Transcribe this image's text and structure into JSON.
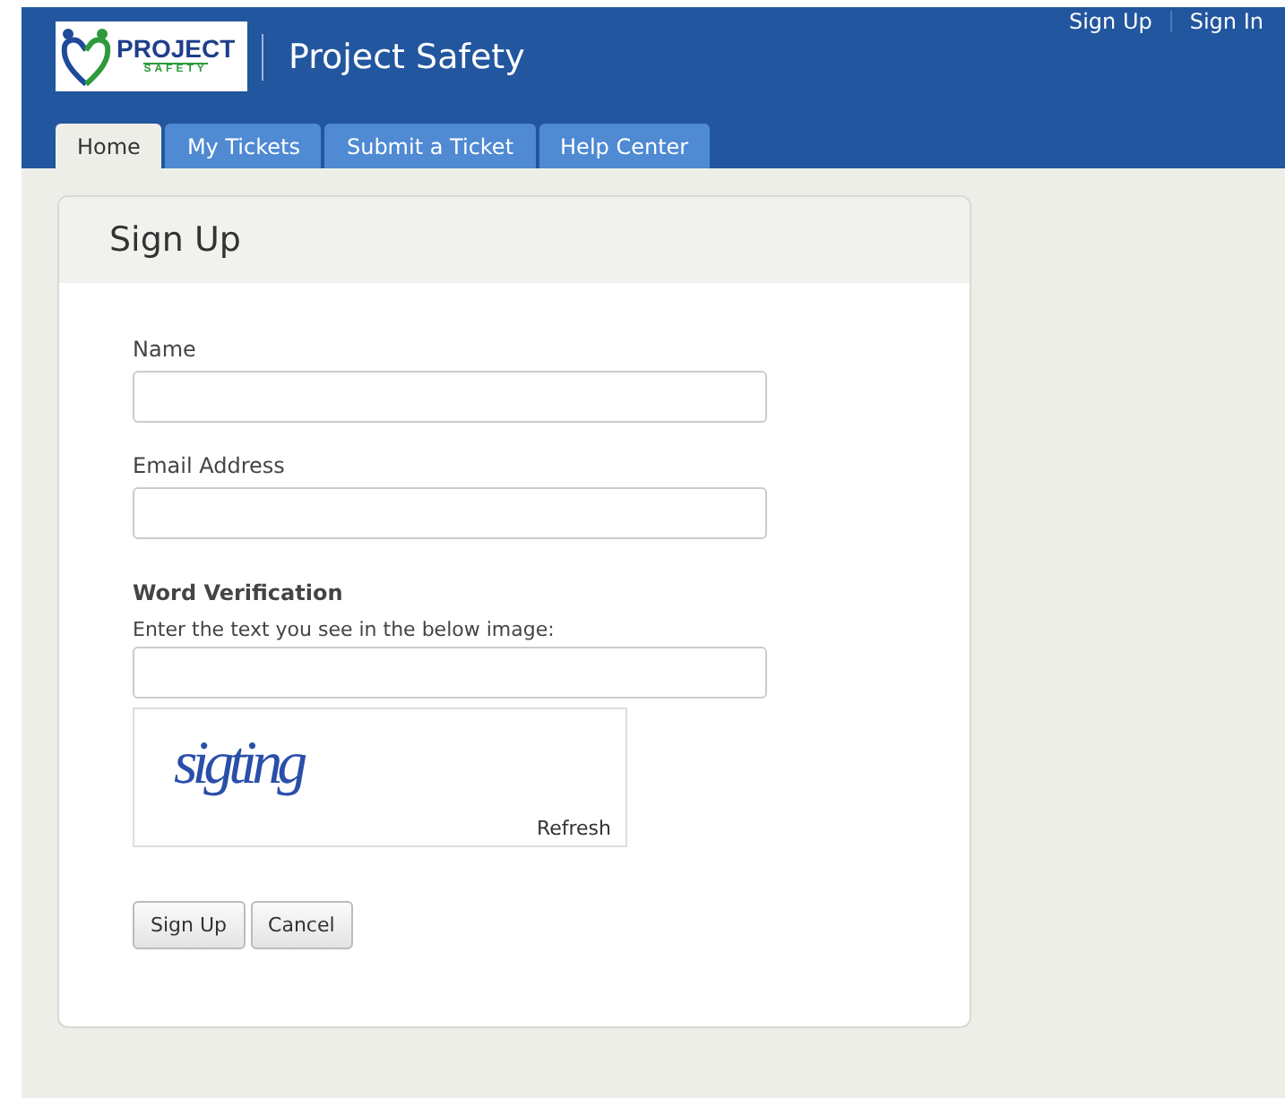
{
  "logo": {
    "word": "PROJECT",
    "subword": "SAFETY"
  },
  "site_title": "Project Safety",
  "top_links": [
    "Sign Up",
    "Sign In"
  ],
  "tabs": [
    {
      "label": "Home",
      "selected": true
    },
    {
      "label": "My Tickets",
      "selected": false
    },
    {
      "label": "Submit a Ticket",
      "selected": false
    },
    {
      "label": "Help Center",
      "selected": false
    }
  ],
  "form": {
    "title": "Sign Up",
    "fields": [
      {
        "label": "Name"
      },
      {
        "label": "Email Address"
      }
    ],
    "verification": {
      "heading": "Word Verification",
      "prompt": "Enter the text you see in the below image:",
      "captcha_text": "sigting",
      "refresh": "Refresh"
    },
    "buttons": [
      "Sign Up",
      "Cancel"
    ]
  }
}
